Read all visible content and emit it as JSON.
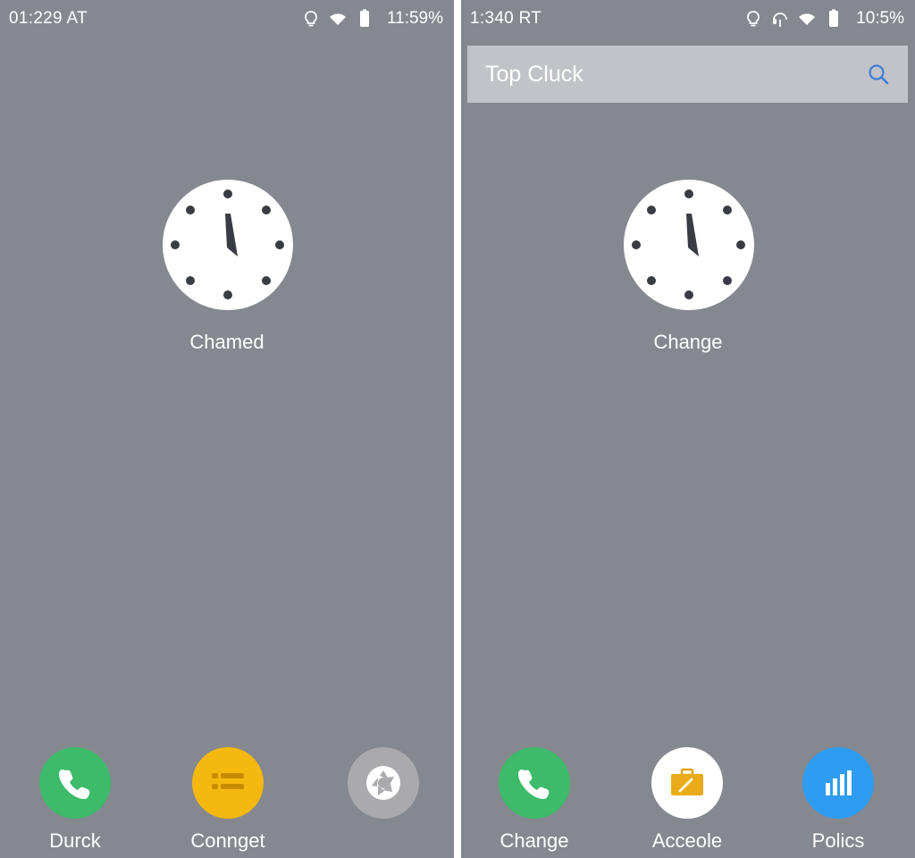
{
  "left_screen": {
    "status": {
      "time": "01:229 AT",
      "battery": "11:59%"
    },
    "clock": {
      "label": "Chamed"
    },
    "dock": [
      {
        "label": "Durck",
        "icon": "phone-icon",
        "color": "#3dba6a"
      },
      {
        "label": "Connget",
        "icon": "list-icon",
        "color": "#f5b80f"
      },
      {
        "label": "",
        "icon": "aperture-icon",
        "color": "#a9a9ae"
      }
    ]
  },
  "right_screen": {
    "status": {
      "time": "1:340 RT",
      "battery": "10:5%"
    },
    "search": {
      "text": "Top Cluck"
    },
    "clock": {
      "label": "Change"
    },
    "dock": [
      {
        "label": "Change",
        "icon": "phone-icon",
        "color": "#3dba6a"
      },
      {
        "label": "Acceole",
        "icon": "briefcase-icon",
        "color": "#ffffff"
      },
      {
        "label": "Polics",
        "icon": "bar-chart-icon",
        "color": "#2e9cf0"
      }
    ]
  }
}
